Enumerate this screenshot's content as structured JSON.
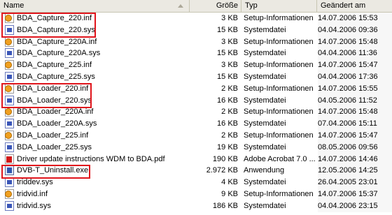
{
  "columns": {
    "name": "Name",
    "size": "Größe",
    "type": "Typ",
    "modified": "Geändert am"
  },
  "files": [
    {
      "name": "BDA_Capture_220.inf",
      "size": "3 KB",
      "type": "Setup-Informationen",
      "modified": "14.07.2006 15:53",
      "icon": "inf-file-icon"
    },
    {
      "name": "BDA_Capture_220.sys",
      "size": "15 KB",
      "type": "Systemdatei",
      "modified": "04.04.2006 09:36",
      "icon": "sys-file-icon"
    },
    {
      "name": "BDA_Capture_220A.inf",
      "size": "3 KB",
      "type": "Setup-Informationen",
      "modified": "14.07.2006 15:48",
      "icon": "inf-file-icon"
    },
    {
      "name": "BDA_Capture_220A.sys",
      "size": "15 KB",
      "type": "Systemdatei",
      "modified": "04.04.2006 11:36",
      "icon": "sys-file-icon"
    },
    {
      "name": "BDA_Capture_225.inf",
      "size": "3 KB",
      "type": "Setup-Informationen",
      "modified": "14.07.2006 15:47",
      "icon": "inf-file-icon"
    },
    {
      "name": "BDA_Capture_225.sys",
      "size": "15 KB",
      "type": "Systemdatei",
      "modified": "04.04.2006 17:36",
      "icon": "sys-file-icon"
    },
    {
      "name": "BDA_Loader_220.inf",
      "size": "2 KB",
      "type": "Setup-Informationen",
      "modified": "14.07.2006 15:55",
      "icon": "inf-file-icon"
    },
    {
      "name": "BDA_Loader_220.sys",
      "size": "16 KB",
      "type": "Systemdatei",
      "modified": "04.05.2006 11:52",
      "icon": "sys-file-icon"
    },
    {
      "name": "BDA_Loader_220A.inf",
      "size": "2 KB",
      "type": "Setup-Informationen",
      "modified": "14.07.2006 15:48",
      "icon": "inf-file-icon"
    },
    {
      "name": "BDA_Loader_220A.sys",
      "size": "16 KB",
      "type": "Systemdatei",
      "modified": "07.04.2006 15:11",
      "icon": "sys-file-icon"
    },
    {
      "name": "BDA_Loader_225.inf",
      "size": "2 KB",
      "type": "Setup-Informationen",
      "modified": "14.07.2006 15:47",
      "icon": "inf-file-icon"
    },
    {
      "name": "BDA_Loader_225.sys",
      "size": "19 KB",
      "type": "Systemdatei",
      "modified": "08.05.2006 09:56",
      "icon": "sys-file-icon"
    },
    {
      "name": "Driver update instructions WDM to BDA.pdf",
      "size": "190 KB",
      "type": "Adobe Acrobat 7.0 ...",
      "modified": "14.07.2006 14:46",
      "icon": "pdf-file-icon"
    },
    {
      "name": "DVB-T_Uninstall.exe",
      "size": "2.972 KB",
      "type": "Anwendung",
      "modified": "12.05.2006 14:25",
      "icon": "exe-file-icon"
    },
    {
      "name": "triddev.sys",
      "size": "4 KB",
      "type": "Systemdatei",
      "modified": "26.04.2005 23:01",
      "icon": "sys-file-icon"
    },
    {
      "name": "tridvid.inf",
      "size": "9 KB",
      "type": "Setup-Informationen",
      "modified": "14.07.2006 15:37",
      "icon": "inf-file-icon"
    },
    {
      "name": "tridvid.sys",
      "size": "186 KB",
      "type": "Systemdatei",
      "modified": "04.04.2006 23:15",
      "icon": "sys-file-icon"
    }
  ],
  "highlight_color": "#e0151c"
}
